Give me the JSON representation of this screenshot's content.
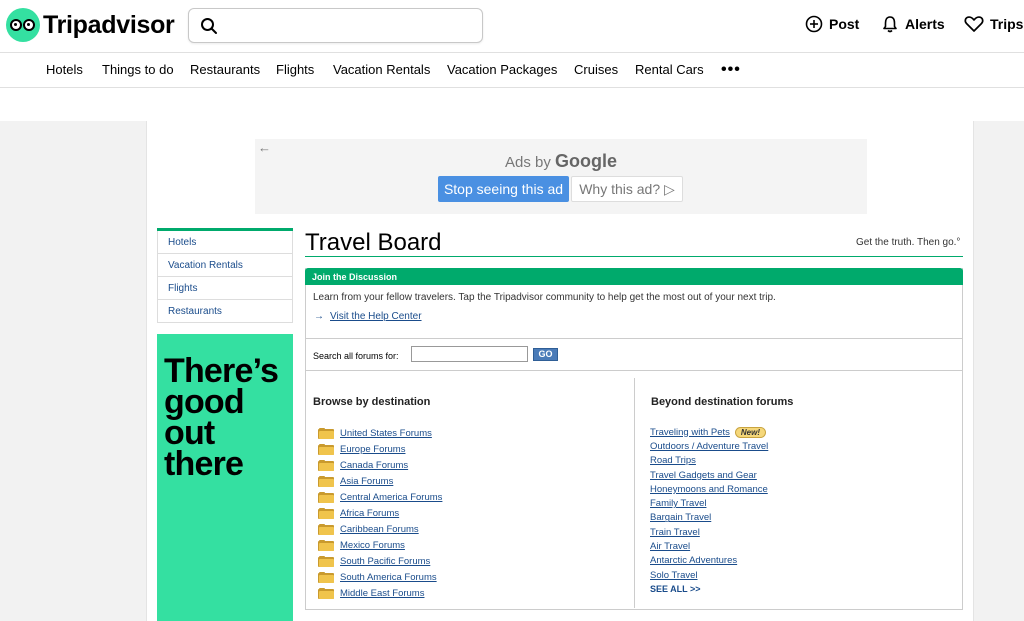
{
  "header": {
    "logo_text": "Tripadvisor",
    "search_placeholder": "",
    "actions": {
      "post": "Post",
      "alerts": "Alerts",
      "trips": "Trips"
    }
  },
  "nav": {
    "items": [
      "Hotels",
      "Things to do",
      "Restaurants",
      "Flights",
      "Vacation Rentals",
      "Vacation Packages",
      "Cruises",
      "Rental Cars"
    ],
    "more": "•••"
  },
  "ad": {
    "back_arrow": "←",
    "ads_by": "Ads by",
    "brand": "Google",
    "stop_label": "Stop seeing this ad",
    "why_label": "Why this ad? ▷"
  },
  "sidebar": {
    "items": [
      "Hotels",
      "Vacation Rentals",
      "Flights",
      "Restaurants"
    ],
    "promo_lines": [
      "There’s",
      "good",
      "out",
      "there"
    ]
  },
  "main": {
    "title": "Travel Board",
    "tagline": "Get the truth. Then go.°",
    "panel_title": "Join the Discussion",
    "description": "Learn from your fellow travelers. Tap the Tripadvisor community to help get the most out of your next trip.",
    "help_arrow": "→",
    "help_link": "Visit the Help Center",
    "search_label": "Search all forums for:",
    "search_value": "",
    "go_label": "GO",
    "browse_heading": "Browse by destination",
    "beyond_heading": "Beyond destination forums",
    "destinations": [
      "United States Forums",
      "Europe Forums",
      "Canada Forums",
      "Asia Forums",
      "Central America Forums",
      "Africa Forums",
      "Caribbean Forums",
      "Mexico Forums",
      "South Pacific Forums",
      "South America Forums",
      "Middle East Forums"
    ],
    "beyond": [
      "Traveling with Pets",
      "Outdoors / Adventure Travel",
      "Road Trips",
      "Travel Gadgets and Gear",
      "Honeymoons and Romance",
      "Family Travel",
      "Bargain Travel",
      "Train Travel",
      "Air Travel",
      "Antarctic Adventures",
      "Solo Travel"
    ],
    "new_badge": "New!",
    "see_all": "SEE ALL >>"
  },
  "colors": {
    "brand_green": "#34e0a1",
    "accent_green": "#00aa6c",
    "link_blue": "#1a4c8b",
    "ad_button_blue": "#4a90e2"
  }
}
